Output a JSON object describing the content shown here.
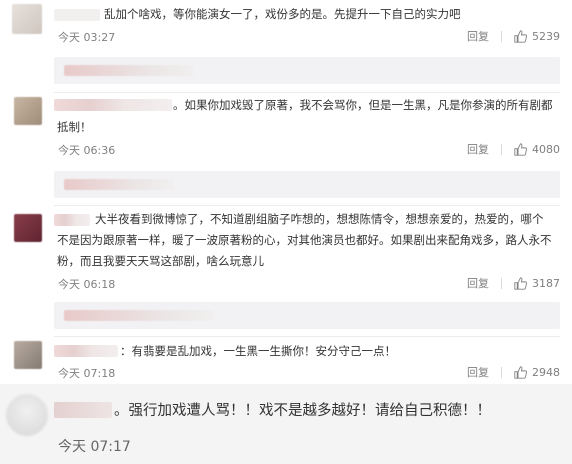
{
  "comments": [
    {
      "text": "乱加个啥戏，等你能演女一了，戏份多的是。先提升一下自己的实力吧",
      "time": "今天 03:27",
      "reply_label": "回复",
      "likes": "5239"
    },
    {
      "text_line1": "。如果你加戏毁了原著，我不会骂你，但是一生黑，凡是你参演的所有剧都",
      "text_line2": "抵制！",
      "time": "今天 06:36",
      "reply_label": "回复",
      "likes": "4080"
    },
    {
      "text_line1": "大半夜看到微博惊了，不知道剧组脑子咋想的，想想陈情令，想想亲爱的，热爱的，哪个",
      "text_line2": "不是因为跟原著一样，暖了一波原著粉的心，对其他演员也都好。如果剧出来配角戏多，路人永不",
      "text_line3": "粉，而且我要天天骂这部剧，啥么玩意儿",
      "time": "今天 06:18",
      "reply_label": "回复",
      "likes": "3187"
    },
    {
      "text": "：有翡要是乱加戏，一生黑一生撕你！安分守己一点！",
      "time": "今天 07:18",
      "reply_label": "回复",
      "likes": "2948"
    }
  ],
  "bottom_comment": {
    "text": "。强行加戏遭人骂！！戏不是越多越好！请给自己积德！！",
    "time": "今天 07:17"
  },
  "colors": {
    "text": "#333333",
    "meta": "#808080",
    "subreply_bg": "#f2f2f5",
    "bottom_bg": "#f4f4f4"
  }
}
